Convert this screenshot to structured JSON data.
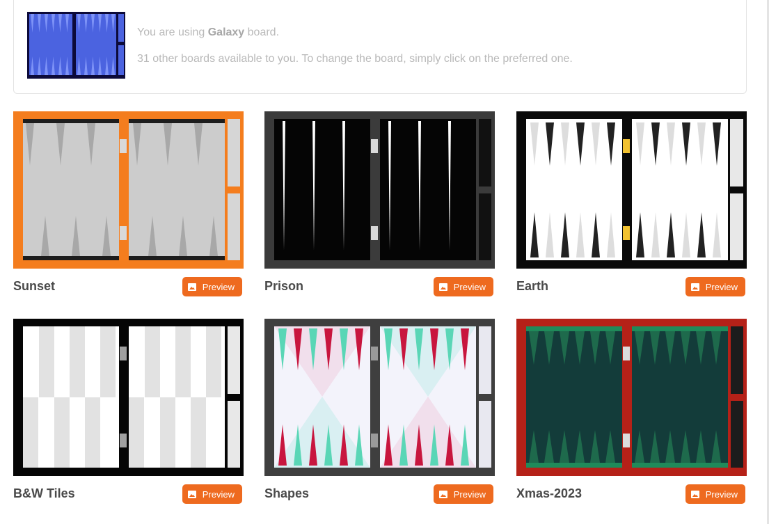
{
  "current_board": {
    "prefix": "You are using ",
    "name": "Galaxy",
    "suffix": " board.",
    "hint": "31 other boards available to you. To change the board, simply click on the preferred one.",
    "thumb_icon": "galaxy-board-thumbnail"
  },
  "preview_label": "Preview",
  "preview_icon": "image-icon",
  "boards": [
    {
      "name": "Sunset"
    },
    {
      "name": "Prison"
    },
    {
      "name": "Earth"
    },
    {
      "name": "B&W Tiles"
    },
    {
      "name": "Shapes"
    },
    {
      "name": "Xmas-2023"
    }
  ],
  "colors": {
    "accent": "#ee6a1f",
    "sunset_frame": "#f47d1e",
    "xmas_frame": "#b52118",
    "galaxy_field": "#4b63e0"
  }
}
